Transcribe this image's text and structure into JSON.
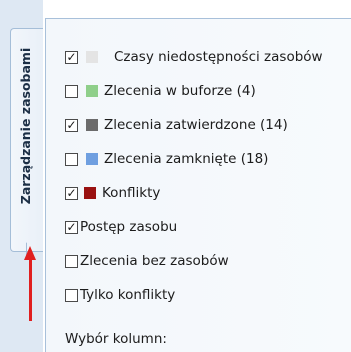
{
  "panel": {
    "tab_label": "Zarządzanie zasobami",
    "options": [
      {
        "label": "Czasy niedostępności zasobów",
        "checked": true,
        "swatch": "#e4e4e4",
        "icon": "gray-swatch-icon"
      },
      {
        "label": "Zlecenia w buforze (4)",
        "checked": false,
        "swatch": "#8fcf8a",
        "icon": "green-swatch-icon"
      },
      {
        "label": "Zlecenia zatwierdzone (14)",
        "checked": true,
        "swatch": "#6b6b6b",
        "icon": "dark-gray-swatch-icon"
      },
      {
        "label": "Zlecenia zamknięte (18)",
        "checked": false,
        "swatch": "#6f9fe0",
        "icon": "blue-swatch-icon"
      },
      {
        "label": "Konflikty",
        "checked": true,
        "swatch": "#9a1111",
        "icon": "dark-red-swatch-icon"
      },
      {
        "label": "Postęp zasobu",
        "checked": true
      },
      {
        "label": "Zlecenia bez zasobów",
        "checked": false
      },
      {
        "label": "Tylko konflikty",
        "checked": false
      }
    ],
    "column_selection_label": "Wybór kolumn:"
  },
  "colors": {
    "arrow": "#e01f1f",
    "panel_border": "#a8c0da",
    "strip_background": "#dee8f3"
  }
}
